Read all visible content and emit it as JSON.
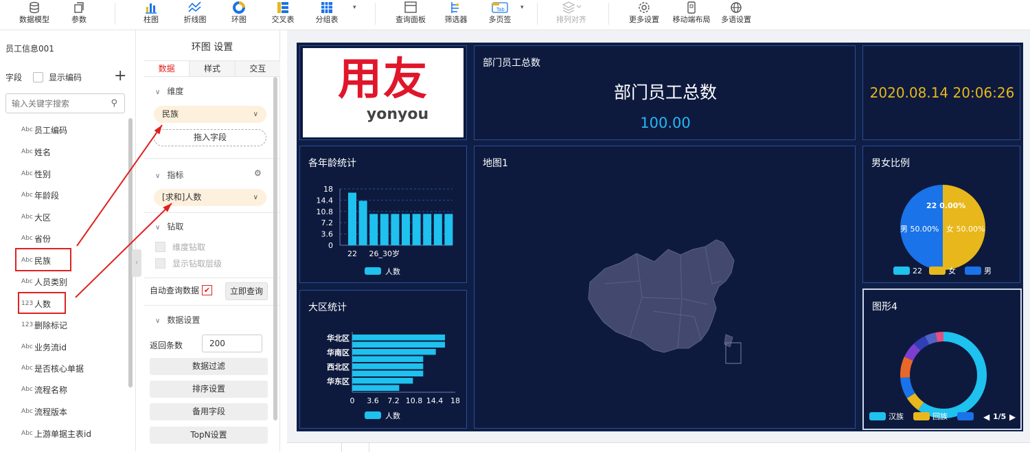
{
  "toolbar": {
    "items": [
      {
        "label": "数据模型",
        "icon": "database-icon"
      },
      {
        "label": "参数",
        "icon": "param-icon"
      },
      {
        "label": "柱图",
        "icon": "bar-chart-icon"
      },
      {
        "label": "折线图",
        "icon": "line-chart-icon"
      },
      {
        "label": "环图",
        "icon": "ring-chart-icon"
      },
      {
        "label": "交叉表",
        "icon": "cross-table-icon"
      },
      {
        "label": "分组表",
        "icon": "group-table-icon"
      },
      {
        "label": "查询面板",
        "icon": "query-panel-icon"
      },
      {
        "label": "筛选器",
        "icon": "filter-icon"
      },
      {
        "label": "多页签",
        "icon": "tab-icon"
      },
      {
        "label": "排列对齐",
        "icon": "align-icon"
      },
      {
        "label": "更多设置",
        "icon": "gear-icon"
      },
      {
        "label": "移动端布局",
        "icon": "mobile-icon"
      },
      {
        "label": "多语设置",
        "icon": "globe-icon"
      }
    ],
    "tab_icon_text": "Tab"
  },
  "fields_panel": {
    "dataset_name": "员工信息001",
    "fields_label": "字段",
    "show_code_label": "显示编码",
    "search_placeholder": "输入关键字搜索",
    "fields": [
      {
        "type": "Abc",
        "name": "员工编码"
      },
      {
        "type": "Abc",
        "name": "姓名"
      },
      {
        "type": "Abc",
        "name": "性别"
      },
      {
        "type": "Abc",
        "name": "年龄段"
      },
      {
        "type": "Abc",
        "name": "大区"
      },
      {
        "type": "Abc",
        "name": "省份"
      },
      {
        "type": "Abc",
        "name": "民族"
      },
      {
        "type": "Abc",
        "name": "人员类别"
      },
      {
        "type": "123",
        "name": "人数"
      },
      {
        "type": "123",
        "name": "删除标记"
      },
      {
        "type": "Abc",
        "name": "业务流id"
      },
      {
        "type": "Abc",
        "name": "是否核心单据"
      },
      {
        "type": "Abc",
        "name": "流程名称"
      },
      {
        "type": "Abc",
        "name": "流程版本"
      },
      {
        "type": "Abc",
        "name": "上游单据主表id"
      }
    ]
  },
  "settings_panel": {
    "title": "环图 设置",
    "tabs": [
      "数据",
      "样式",
      "交互"
    ],
    "dimension_label": "维度",
    "dimension_value": "民族",
    "drop_field": "拖入字段",
    "metric_label": "指标",
    "metric_value": "[求和]人数",
    "drill_label": "钻取",
    "dim_drill": "维度钻取",
    "show_drill_level": "显示钻取层级",
    "auto_query": "自动查询数据",
    "query_now": "立即查询",
    "data_settings": "数据设置",
    "return_rows_label": "返回条数",
    "return_rows": "200",
    "buttons": [
      "数据过滤",
      "排序设置",
      "备用字段",
      "TopN设置"
    ]
  },
  "dashboard": {
    "logo_main": "用友",
    "logo_sub": "yonyou",
    "kpi_title": "部门员工总数",
    "kpi_big": "部门员工总数",
    "kpi_value": "100.00",
    "datetime": "2020.08.14 20:06:26",
    "map_title": "地图1",
    "age_title": "各年龄统计",
    "region_title": "大区统计",
    "gender_title": "男女比例",
    "shape_title": "图形4",
    "pager": "1/5",
    "colors": {
      "bar": "#1fc1ee",
      "yellow": "#e8b71b",
      "blue": "#1a73e8",
      "bg": "#0f1e45",
      "border": "#2a4d96"
    }
  },
  "chart_data": [
    {
      "type": "bar",
      "title": "各年龄统计",
      "categories": [
        "22",
        "",
        "",
        "26_30岁",
        "",
        "",
        "",
        "",
        "",
        ""
      ],
      "series": [
        {
          "name": "人数",
          "values": [
            16.8,
            14.2,
            10,
            10,
            10,
            10,
            10,
            10,
            10,
            10
          ]
        }
      ],
      "yticks": [
        "18",
        "14.4",
        "10.8",
        "7.2",
        "3.6",
        "0"
      ],
      "ylim": [
        0,
        18
      ]
    },
    {
      "type": "bar",
      "orientation": "horizontal",
      "title": "大区统计",
      "categories": [
        "华北区",
        "",
        "华南区",
        "",
        "西北区",
        "",
        "华东区",
        ""
      ],
      "series": [
        {
          "name": "人数",
          "values": [
            16.2,
            16.2,
            14.6,
            12.4,
            12.4,
            12.4,
            10.6,
            8.2
          ]
        }
      ],
      "xticks": [
        "0",
        "3.6",
        "7.2",
        "10.8",
        "14.4",
        "18"
      ],
      "xlim": [
        0,
        18
      ]
    },
    {
      "type": "pie",
      "title": "男女比例",
      "slices": [
        {
          "label": "22",
          "value": 0,
          "text": "22 0.00%",
          "color": "#1fc1ee"
        },
        {
          "label": "女",
          "value": 50,
          "text": "女 50.00%",
          "color": "#e8b71b"
        },
        {
          "label": "男",
          "value": 50,
          "text": "男 50.00%",
          "color": "#1a73e8"
        }
      ]
    },
    {
      "type": "pie",
      "style": "donut",
      "title": "图形4",
      "slices": [
        {
          "label": "汉族",
          "value": 60,
          "color": "#1fc1ee"
        },
        {
          "label": "回族",
          "value": 6,
          "color": "#e8b71b"
        },
        {
          "label": "",
          "value": 8,
          "color": "#1a73e8"
        },
        {
          "label": "",
          "value": 8,
          "color": "#e8672a"
        },
        {
          "label": "",
          "value": 6,
          "color": "#7b3fd0"
        },
        {
          "label": "",
          "value": 5,
          "color": "#2f3fb5"
        },
        {
          "label": "",
          "value": 4,
          "color": "#4f64c8"
        },
        {
          "label": "",
          "value": 3,
          "color": "#e05080"
        }
      ],
      "legend": [
        "汉族",
        "回族",
        ""
      ]
    }
  ]
}
